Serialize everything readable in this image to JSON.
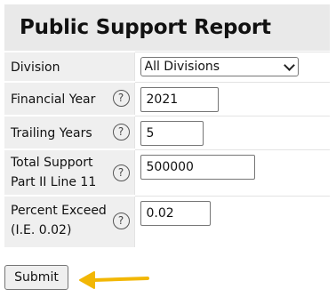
{
  "report": {
    "title": "Public Support Report",
    "fields": {
      "division": {
        "label": "Division",
        "value": "All Divisions"
      },
      "financial_year": {
        "label": "Financial Year",
        "value": "2021"
      },
      "trailing_years": {
        "label": "Trailing Years",
        "value": "5"
      },
      "total_support": {
        "label_line1": "Total Support",
        "label_line2": "Part II Line 11",
        "value": "500000"
      },
      "percent_exceed": {
        "label_line1": "Percent Exceed",
        "label_line2": "(I.E. 0.02)",
        "value": "0.02"
      }
    },
    "help_glyph": "?",
    "submit_label": "Submit"
  },
  "colors": {
    "title_bg": "#e9e9e9",
    "label_bg": "#efefef",
    "arrow": "#f2b705"
  },
  "icons": {
    "help": "question-circle-icon",
    "annotation": "left-arrow-icon"
  }
}
